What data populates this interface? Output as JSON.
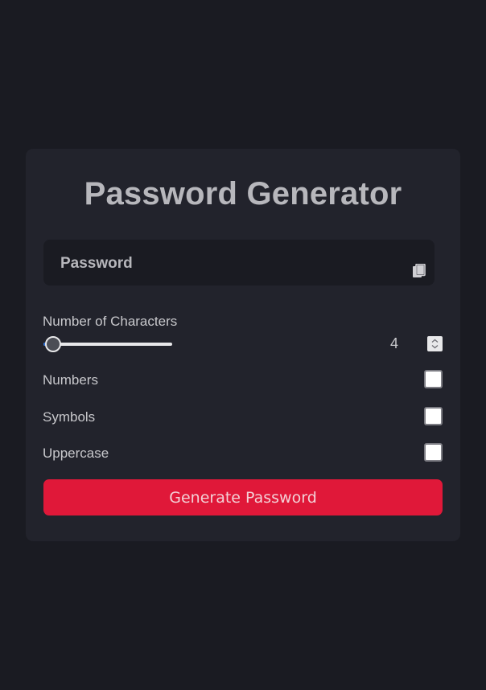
{
  "app": {
    "title": "Password Generator"
  },
  "password": {
    "value": "Password",
    "copy_icon": "copy-icon"
  },
  "length": {
    "label": "Number of Characters",
    "value": "4",
    "min": 4,
    "max": 32,
    "fraction": 0.0
  },
  "options": [
    {
      "label": "Numbers",
      "checked": false
    },
    {
      "label": "Symbols",
      "checked": false
    },
    {
      "label": "Uppercase",
      "checked": false
    }
  ],
  "actions": {
    "generate_label": "Generate Password"
  },
  "colors": {
    "background": "#1a1b22",
    "card": "#22232c",
    "accent": "#e01839",
    "slider_fill": "#2b6fd6"
  }
}
